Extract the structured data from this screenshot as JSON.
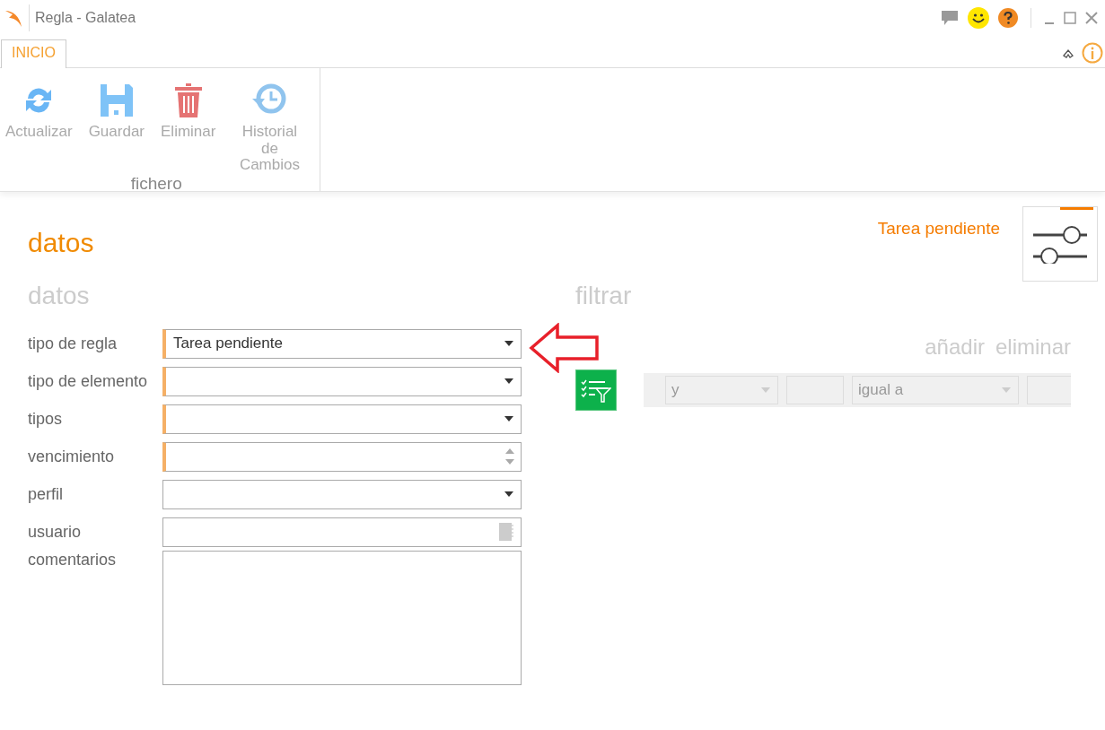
{
  "window": {
    "title": "Regla - Galatea"
  },
  "tabs": [
    {
      "label": "INICIO",
      "selected": true
    }
  ],
  "ribbon": {
    "groups": [
      {
        "label": "fichero",
        "buttons": [
          {
            "kind": "refresh",
            "label": "Actualizar"
          },
          {
            "kind": "save",
            "label": "Guardar"
          },
          {
            "kind": "delete",
            "label": "Eliminar"
          },
          {
            "kind": "history",
            "label": "Historial de Cambios"
          }
        ]
      }
    ]
  },
  "page": {
    "title": "datos",
    "status": "Tarea pendiente"
  },
  "form": {
    "heading": "datos",
    "fields": [
      {
        "label": "tipo de regla",
        "kind": "select",
        "required": true,
        "value": "Tarea pendiente"
      },
      {
        "label": "tipo de elemento",
        "kind": "select",
        "required": true
      },
      {
        "label": "tipos",
        "kind": "select",
        "required": true
      },
      {
        "label": "vencimiento",
        "kind": "spinner",
        "required": true
      },
      {
        "label": "perfil",
        "kind": "select",
        "required": false
      },
      {
        "label": "usuario",
        "kind": "lookup",
        "required": false
      },
      {
        "label": "comentarios",
        "kind": "textarea",
        "required": false
      }
    ]
  },
  "filter": {
    "heading": "filtrar",
    "actions": [
      "añadir",
      "eliminar"
    ],
    "row": [
      {
        "kind": "select",
        "value": "y"
      },
      {
        "kind": "input"
      },
      {
        "kind": "select",
        "value": "igual a"
      },
      {
        "kind": "input"
      }
    ]
  }
}
